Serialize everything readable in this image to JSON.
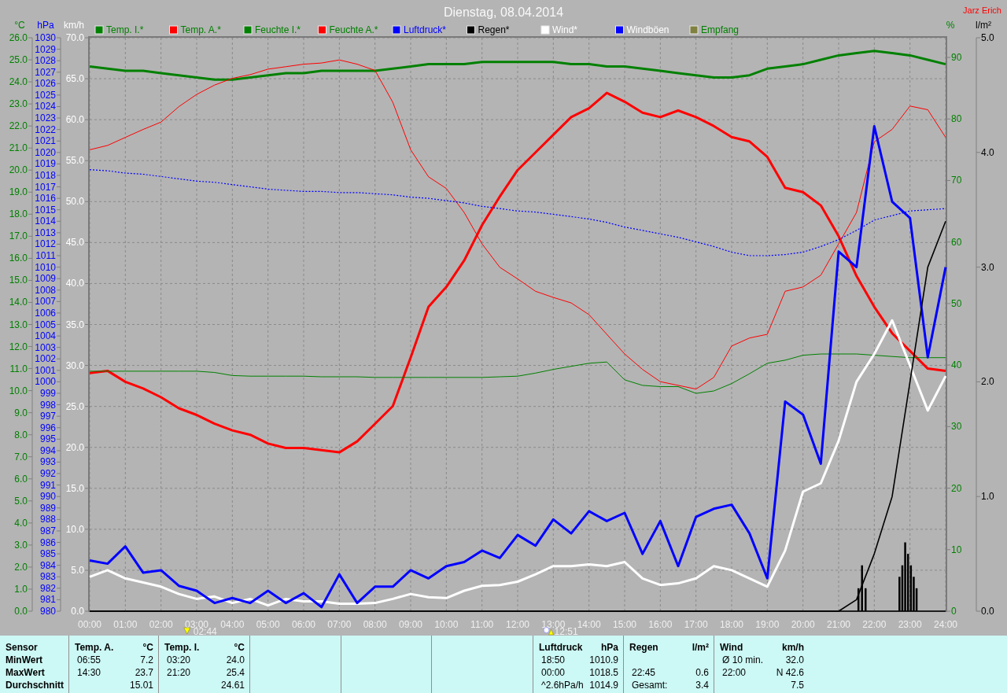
{
  "title": "Dienstag, 08.04.2014",
  "author": "Jarz Erich",
  "chart": {
    "chart_data": {
      "type": "line",
      "legend": "top",
      "grid": true,
      "xlim": [
        0,
        24
      ],
      "ylabel": "km/h",
      "ylim": [
        0,
        70
      ],
      "yticks": [
        {
          "value": 0,
          "label": "0.0"
        },
        {
          "value": 5,
          "label": "5.0"
        },
        {
          "value": 10,
          "label": "10.0"
        },
        {
          "value": 15,
          "label": "15.0"
        },
        {
          "value": 20,
          "label": "20.0"
        },
        {
          "value": 25,
          "label": "25.0"
        },
        {
          "value": 30,
          "label": "30.0"
        },
        {
          "value": 35,
          "label": "35.0"
        },
        {
          "value": 40,
          "label": "40.0"
        },
        {
          "value": 45,
          "label": "45.0"
        },
        {
          "value": 50,
          "label": "50.0"
        },
        {
          "value": 55,
          "label": "55.0"
        },
        {
          "value": 60,
          "label": "60.0"
        },
        {
          "value": 65,
          "label": "65.0"
        },
        {
          "value": 70,
          "label": "70.0"
        }
      ],
      "y2label": "%",
      "y2lim": [
        0,
        93.2
      ],
      "y2ticks": [
        {
          "value": 0,
          "label": "0"
        },
        {
          "value": 10,
          "label": "10"
        },
        {
          "value": 20,
          "label": "20"
        },
        {
          "value": 30,
          "label": "30"
        },
        {
          "value": 40,
          "label": "40"
        },
        {
          "value": 50,
          "label": "50"
        },
        {
          "value": 60,
          "label": "60"
        },
        {
          "value": 70,
          "label": "70"
        },
        {
          "value": 80,
          "label": "80"
        },
        {
          "value": 90,
          "label": "90"
        }
      ],
      "y3label": "°C",
      "y3lim": [
        0,
        26
      ],
      "y3ticks": [
        {
          "value": 0,
          "label": "0.0"
        },
        {
          "value": 1,
          "label": "1.0"
        },
        {
          "value": 2,
          "label": "2.0"
        },
        {
          "value": 3,
          "label": "3.0"
        },
        {
          "value": 4,
          "label": "4.0"
        },
        {
          "value": 5,
          "label": "5.0"
        },
        {
          "value": 6,
          "label": "6.0"
        },
        {
          "value": 7,
          "label": "7.0"
        },
        {
          "value": 8,
          "label": "8.0"
        },
        {
          "value": 9,
          "label": "9.0"
        },
        {
          "value": 10,
          "label": "10.0"
        },
        {
          "value": 11,
          "label": "11.0"
        },
        {
          "value": 12,
          "label": "12.0"
        },
        {
          "value": 13,
          "label": "13.0"
        },
        {
          "value": 14,
          "label": "14.0"
        },
        {
          "value": 15,
          "label": "15.0"
        },
        {
          "value": 16,
          "label": "16.0"
        },
        {
          "value": 17,
          "label": "17.0"
        },
        {
          "value": 18,
          "label": "18.0"
        },
        {
          "value": 19,
          "label": "19.0"
        },
        {
          "value": 20,
          "label": "20.0"
        },
        {
          "value": 21,
          "label": "21.0"
        },
        {
          "value": 22,
          "label": "22.0"
        },
        {
          "value": 23,
          "label": "23.0"
        },
        {
          "value": 24,
          "label": "24.0"
        },
        {
          "value": 25,
          "label": "25.0"
        },
        {
          "value": 26,
          "label": "26.0"
        }
      ],
      "x": [
        0,
        0.5,
        1,
        1.5,
        2,
        2.5,
        3,
        3.5,
        4,
        4.5,
        5,
        5.5,
        6,
        6.5,
        7,
        7.5,
        8,
        8.5,
        9,
        9.5,
        10,
        10.5,
        11,
        11.5,
        12,
        12.5,
        13,
        13.5,
        14,
        14.5,
        15,
        15.5,
        16,
        16.5,
        17,
        17.5,
        18,
        18.5,
        19,
        19.5,
        20,
        20.5,
        21,
        21.5,
        22,
        22.5,
        23,
        23.5,
        24
      ],
      "xticks": [
        {
          "value": 0,
          "label": "00:00"
        },
        {
          "value": 1,
          "label": "01:00"
        },
        {
          "value": 2,
          "label": "02:00"
        },
        {
          "value": 3,
          "label": "03:00"
        },
        {
          "value": 4,
          "label": "04:00"
        },
        {
          "value": 5,
          "label": "05:00"
        },
        {
          "value": 6,
          "label": "06:00"
        },
        {
          "value": 7,
          "label": "07:00"
        },
        {
          "value": 8,
          "label": "08:00"
        },
        {
          "value": 9,
          "label": "09:00"
        },
        {
          "value": 10,
          "label": "10:00"
        },
        {
          "value": 11,
          "label": "11:00"
        },
        {
          "value": 12,
          "label": "12:00"
        },
        {
          "value": 13,
          "label": "13:00"
        },
        {
          "value": 14,
          "label": "14:00"
        },
        {
          "value": 15,
          "label": "15:00"
        },
        {
          "value": 16,
          "label": "16:00"
        },
        {
          "value": 17,
          "label": "17:00"
        },
        {
          "value": 18,
          "label": "18:00"
        },
        {
          "value": 19,
          "label": "19:00"
        },
        {
          "value": 20,
          "label": "20:00"
        },
        {
          "value": 21,
          "label": "21:00"
        },
        {
          "value": 22,
          "label": "22:00"
        },
        {
          "value": 23,
          "label": "23:00"
        },
        {
          "value": 24,
          "label": "24:00"
        }
      ],
      "series": [
        {
          "name": "Temp. I.*",
          "color": "#008000",
          "axis": "y3",
          "values": [
            24.7,
            24.6,
            24.5,
            24.5,
            24.4,
            24.3,
            24.2,
            24.1,
            24.1,
            24.2,
            24.3,
            24.4,
            24.4,
            24.5,
            24.5,
            24.5,
            24.5,
            24.6,
            24.7,
            24.8,
            24.8,
            24.8,
            24.9,
            24.9,
            24.9,
            24.9,
            24.9,
            24.8,
            24.8,
            24.7,
            24.7,
            24.6,
            24.5,
            24.4,
            24.3,
            24.2,
            24.2,
            24.3,
            24.6,
            24.7,
            24.8,
            25.0,
            25.2,
            25.3,
            25.4,
            25.3,
            25.2,
            25.0,
            24.8
          ]
        },
        {
          "name": "Temp. A.*",
          "color": "#ff0000",
          "axis": "y3",
          "values": [
            10.8,
            10.9,
            10.4,
            10.1,
            9.7,
            9.2,
            8.9,
            8.5,
            8.2,
            8.0,
            7.6,
            7.4,
            7.4,
            7.3,
            7.2,
            7.7,
            8.5,
            9.3,
            11.5,
            13.8,
            14.7,
            15.9,
            17.5,
            18.8,
            20.0,
            20.8,
            21.6,
            22.4,
            22.8,
            23.5,
            23.1,
            22.6,
            22.4,
            22.7,
            22.4,
            22.0,
            21.5,
            21.3,
            20.6,
            19.2,
            19.0,
            18.4,
            17.0,
            15.2,
            13.8,
            12.6,
            11.8,
            11.0,
            10.9
          ]
        },
        {
          "name": "Feuchte I.*",
          "color": "#008000",
          "axis": "y2",
          "values": [
            39.0,
            39.0,
            39.0,
            39.0,
            39.0,
            39.0,
            39.0,
            38.8,
            38.3,
            38.2,
            38.2,
            38.2,
            38.2,
            38.1,
            38.1,
            38.1,
            38.0,
            38.0,
            38.0,
            38.0,
            38.0,
            38.0,
            38.0,
            38.1,
            38.2,
            38.7,
            39.3,
            39.8,
            40.3,
            40.5,
            37.6,
            36.7,
            36.5,
            36.5,
            35.4,
            35.8,
            37.0,
            38.6,
            40.3,
            40.8,
            41.6,
            41.8,
            41.8,
            41.8,
            41.6,
            41.4,
            41.2,
            41.2,
            41.2
          ]
        },
        {
          "name": "Feuchte A.*",
          "color": "#ff0000",
          "axis": "y2",
          "values": [
            75.0,
            75.7,
            77.0,
            78.3,
            79.5,
            82.0,
            84.0,
            85.5,
            86.6,
            87.2,
            88.1,
            88.5,
            88.9,
            89.1,
            89.6,
            88.9,
            87.9,
            82.7,
            75.0,
            70.6,
            68.7,
            64.8,
            59.7,
            55.9,
            54.0,
            52.0,
            51.0,
            50.1,
            48.2,
            45.0,
            41.8,
            39.3,
            37.3,
            36.7,
            36.1,
            38.0,
            43.1,
            44.4,
            45.0,
            52.0,
            52.7,
            54.6,
            59.7,
            64.8,
            76.3,
            78.3,
            82.1,
            81.5,
            77.0
          ]
        },
        {
          "name": "Wind*",
          "color": "#ffffff",
          "values": [
            4.2,
            5.0,
            4.0,
            3.5,
            3.0,
            2.1,
            1.5,
            1.8,
            1.0,
            1.5,
            0.7,
            1.5,
            1.2,
            1.2,
            0.9,
            0.9,
            1.0,
            1.5,
            2.1,
            1.7,
            1.6,
            2.5,
            3.1,
            3.2,
            3.6,
            4.5,
            5.5,
            5.5,
            5.7,
            5.5,
            6.0,
            4.0,
            3.2,
            3.4,
            4.0,
            5.5,
            5.0,
            4.0,
            3.0,
            7.4,
            14.6,
            15.6,
            20.8,
            28.0,
            31.4,
            35.5,
            30.0,
            24.5,
            28.7
          ]
        },
        {
          "name": "Windböen",
          "color": "#0000ff",
          "values": [
            6.2,
            5.8,
            7.9,
            4.7,
            5.0,
            3.1,
            2.5,
            1.0,
            1.6,
            1.0,
            2.5,
            1.0,
            2.2,
            0.5,
            4.5,
            1.0,
            3.0,
            3.0,
            5.0,
            4.0,
            5.5,
            6.0,
            7.4,
            6.5,
            9.3,
            8.0,
            11.2,
            9.5,
            12.2,
            11.0,
            12.0,
            7.0,
            11.0,
            5.5,
            11.5,
            12.5,
            13.0,
            9.5,
            4.0,
            25.6,
            24.0,
            18.0,
            43.9,
            42.0,
            59.2,
            50.0,
            48.0,
            31.0,
            42.0
          ]
        }
      ]
    },
    "pressure_chart": {
      "chart_data": {
        "type": "line",
        "ylabel": "hPa",
        "xlim": [
          0,
          24
        ],
        "ylim": [
          980,
          1030
        ],
        "yticks": [
          {
            "value": 980,
            "label": "980"
          },
          {
            "value": 981,
            "label": "981"
          },
          {
            "value": 982,
            "label": "982"
          },
          {
            "value": 983,
            "label": "983"
          },
          {
            "value": 984,
            "label": "984"
          },
          {
            "value": 985,
            "label": "985"
          },
          {
            "value": 986,
            "label": "986"
          },
          {
            "value": 987,
            "label": "987"
          },
          {
            "value": 988,
            "label": "988"
          },
          {
            "value": 989,
            "label": "989"
          },
          {
            "value": 990,
            "label": "990"
          },
          {
            "value": 991,
            "label": "991"
          },
          {
            "value": 992,
            "label": "992"
          },
          {
            "value": 993,
            "label": "993"
          },
          {
            "value": 994,
            "label": "994"
          },
          {
            "value": 995,
            "label": "995"
          },
          {
            "value": 996,
            "label": "996"
          },
          {
            "value": 997,
            "label": "997"
          },
          {
            "value": 998,
            "label": "998"
          },
          {
            "value": 999,
            "label": "999"
          },
          {
            "value": 1000,
            "label": "1000"
          },
          {
            "value": 1001,
            "label": "1001"
          },
          {
            "value": 1002,
            "label": "1002"
          },
          {
            "value": 1003,
            "label": "1003"
          },
          {
            "value": 1004,
            "label": "1004"
          },
          {
            "value": 1005,
            "label": "1005"
          },
          {
            "value": 1006,
            "label": "1006"
          },
          {
            "value": 1007,
            "label": "1007"
          },
          {
            "value": 1008,
            "label": "1008"
          },
          {
            "value": 1009,
            "label": "1009"
          },
          {
            "value": 1010,
            "label": "1010"
          },
          {
            "value": 1011,
            "label": "1011"
          },
          {
            "value": 1012,
            "label": "1012"
          },
          {
            "value": 1013,
            "label": "1013"
          },
          {
            "value": 1014,
            "label": "1014"
          },
          {
            "value": 1015,
            "label": "1015"
          },
          {
            "value": 1016,
            "label": "1016"
          },
          {
            "value": 1017,
            "label": "1017"
          },
          {
            "value": 1018,
            "label": "1018"
          },
          {
            "value": 1019,
            "label": "1019"
          },
          {
            "value": 1020,
            "label": "1020"
          },
          {
            "value": 1021,
            "label": "1021"
          },
          {
            "value": 1022,
            "label": "1022"
          },
          {
            "value": 1023,
            "label": "1023"
          },
          {
            "value": 1024,
            "label": "1024"
          },
          {
            "value": 1025,
            "label": "1025"
          },
          {
            "value": 1026,
            "label": "1026"
          },
          {
            "value": 1027,
            "label": "1027"
          },
          {
            "value": 1028,
            "label": "1028"
          },
          {
            "value": 1029,
            "label": "1029"
          },
          {
            "value": 1030,
            "label": "1030"
          }
        ],
        "x": [
          0,
          0.5,
          1,
          1.5,
          2,
          2.5,
          3,
          3.5,
          4,
          4.5,
          5,
          5.5,
          6,
          6.5,
          7,
          7.5,
          8,
          8.5,
          9,
          9.5,
          10,
          10.5,
          11,
          11.5,
          12,
          12.5,
          13,
          13.5,
          14,
          14.5,
          15,
          15.5,
          16,
          16.5,
          17,
          17.5,
          18,
          18.5,
          19,
          19.5,
          20,
          20.5,
          21,
          21.5,
          22,
          22.5,
          23,
          23.5,
          24
        ],
        "series": [
          {
            "name": "Luftdruck*",
            "color": "#0000ff",
            "line_style": "dotted",
            "values": [
              1018.5,
              1018.4,
              1018.2,
              1018.1,
              1017.9,
              1017.7,
              1017.5,
              1017.4,
              1017.2,
              1017.0,
              1016.8,
              1016.7,
              1016.6,
              1016.6,
              1016.5,
              1016.5,
              1016.4,
              1016.3,
              1016.1,
              1016.0,
              1015.8,
              1015.6,
              1015.3,
              1015.1,
              1014.9,
              1014.8,
              1014.6,
              1014.4,
              1014.2,
              1013.9,
              1013.5,
              1013.2,
              1012.9,
              1012.6,
              1012.2,
              1011.8,
              1011.3,
              1011.0,
              1011.0,
              1011.1,
              1011.3,
              1011.8,
              1012.4,
              1013.2,
              1014.1,
              1014.5,
              1014.9,
              1015.0,
              1015.1
            ]
          }
        ]
      }
    },
    "rain_chart": {
      "chart_data": {
        "type": "line",
        "ylabel": "l/m²",
        "xlim": [
          0,
          24
        ],
        "ylim": [
          0,
          5
        ],
        "yticks": [
          {
            "value": 0,
            "label": "0.0"
          },
          {
            "value": 1,
            "label": "1.0"
          },
          {
            "value": 2,
            "label": "2.0"
          },
          {
            "value": 3,
            "label": "3.0"
          },
          {
            "value": 4,
            "label": "4.0"
          },
          {
            "value": 5,
            "label": "5.0"
          }
        ],
        "x": [
          0,
          0.5,
          1,
          1.5,
          2,
          2.5,
          3,
          3.5,
          4,
          4.5,
          5,
          5.5,
          6,
          6.5,
          7,
          7.5,
          8,
          8.5,
          9,
          9.5,
          10,
          10.5,
          11,
          11.5,
          12,
          12.5,
          13,
          13.5,
          14,
          14.5,
          15,
          15.5,
          16,
          16.5,
          17,
          17.5,
          18,
          18.5,
          19,
          19.5,
          20,
          20.5,
          21,
          21.5,
          22,
          22.5,
          23,
          23.5,
          24
        ],
        "series": [
          {
            "name": "Regen*",
            "color": "#000000",
            "values": [
              0,
              0,
              0,
              0,
              0,
              0,
              0,
              0,
              0,
              0,
              0,
              0,
              0,
              0,
              0,
              0,
              0,
              0,
              0,
              0,
              0,
              0,
              0,
              0,
              0,
              0,
              0,
              0,
              0,
              0,
              0,
              0,
              0,
              0,
              0,
              0,
              0,
              0,
              0,
              0,
              0,
              0,
              0,
              0.1,
              0.5,
              1.0,
              2.0,
              3.0,
              3.4
            ]
          }
        ]
      }
    },
    "rain_bars": {
      "chart_data": {
        "type": "bar",
        "xlim": [
          0,
          24
        ],
        "ylim": [
          0,
          5
        ],
        "x": [
          21.55,
          21.65,
          21.75,
          22.7,
          22.78,
          22.86,
          22.94,
          23.02,
          23.1,
          23.18
        ],
        "values": [
          0.2,
          0.4,
          0.2,
          0.3,
          0.4,
          0.6,
          0.5,
          0.4,
          0.3,
          0.2
        ]
      }
    },
    "extra_legend": [
      {
        "name": "Empfang",
        "color": "#808040"
      }
    ],
    "markers": [
      {
        "kind": "sunrise",
        "label": "02:44"
      },
      {
        "kind": "moon",
        "label": "12:51"
      }
    ]
  },
  "stats": {
    "row_labels": [
      "Sensor",
      "MinWert",
      "MaxWert",
      "Durchschnitt"
    ],
    "columns": [
      {
        "kind": "data",
        "header": "Temp. A.",
        "unit": "°C",
        "rows": [
          {
            "time": "06:55",
            "value": "7.2"
          },
          {
            "time": "14:30",
            "value": "23.7"
          },
          {
            "value": "15.01"
          }
        ]
      },
      {
        "kind": "data",
        "header": "Temp. I.",
        "unit": "°C",
        "rows": [
          {
            "time": "03:20",
            "value": "24.0"
          },
          {
            "time": "21:20",
            "value": "25.4"
          },
          {
            "value": "24.61"
          }
        ]
      },
      {
        "kind": "blank"
      },
      {
        "kind": "blank"
      },
      {
        "kind": "blank"
      },
      {
        "kind": "data",
        "header": "Luftdruck",
        "unit": "hPa",
        "rows": [
          {
            "time": "18:50",
            "value": "1010.9"
          },
          {
            "time": "00:00",
            "value": "1018.5"
          },
          {
            "time": "^2.6hPa/h",
            "value": "1014.9"
          }
        ]
      },
      {
        "kind": "data",
        "header": "Regen",
        "unit": "l/m²",
        "rows": [
          {},
          {
            "time": "22:45",
            "value": "0.6"
          },
          {
            "time": "Gesamt:",
            "value": "3.4"
          }
        ]
      },
      {
        "kind": "data",
        "header": "Wind",
        "unit": "km/h",
        "rows": [
          {
            "time": "Ø 10 min.",
            "value": "32.0"
          },
          {
            "time": "22:00",
            "value": "N 42.6"
          },
          {
            "value": "7.5"
          }
        ]
      }
    ]
  }
}
